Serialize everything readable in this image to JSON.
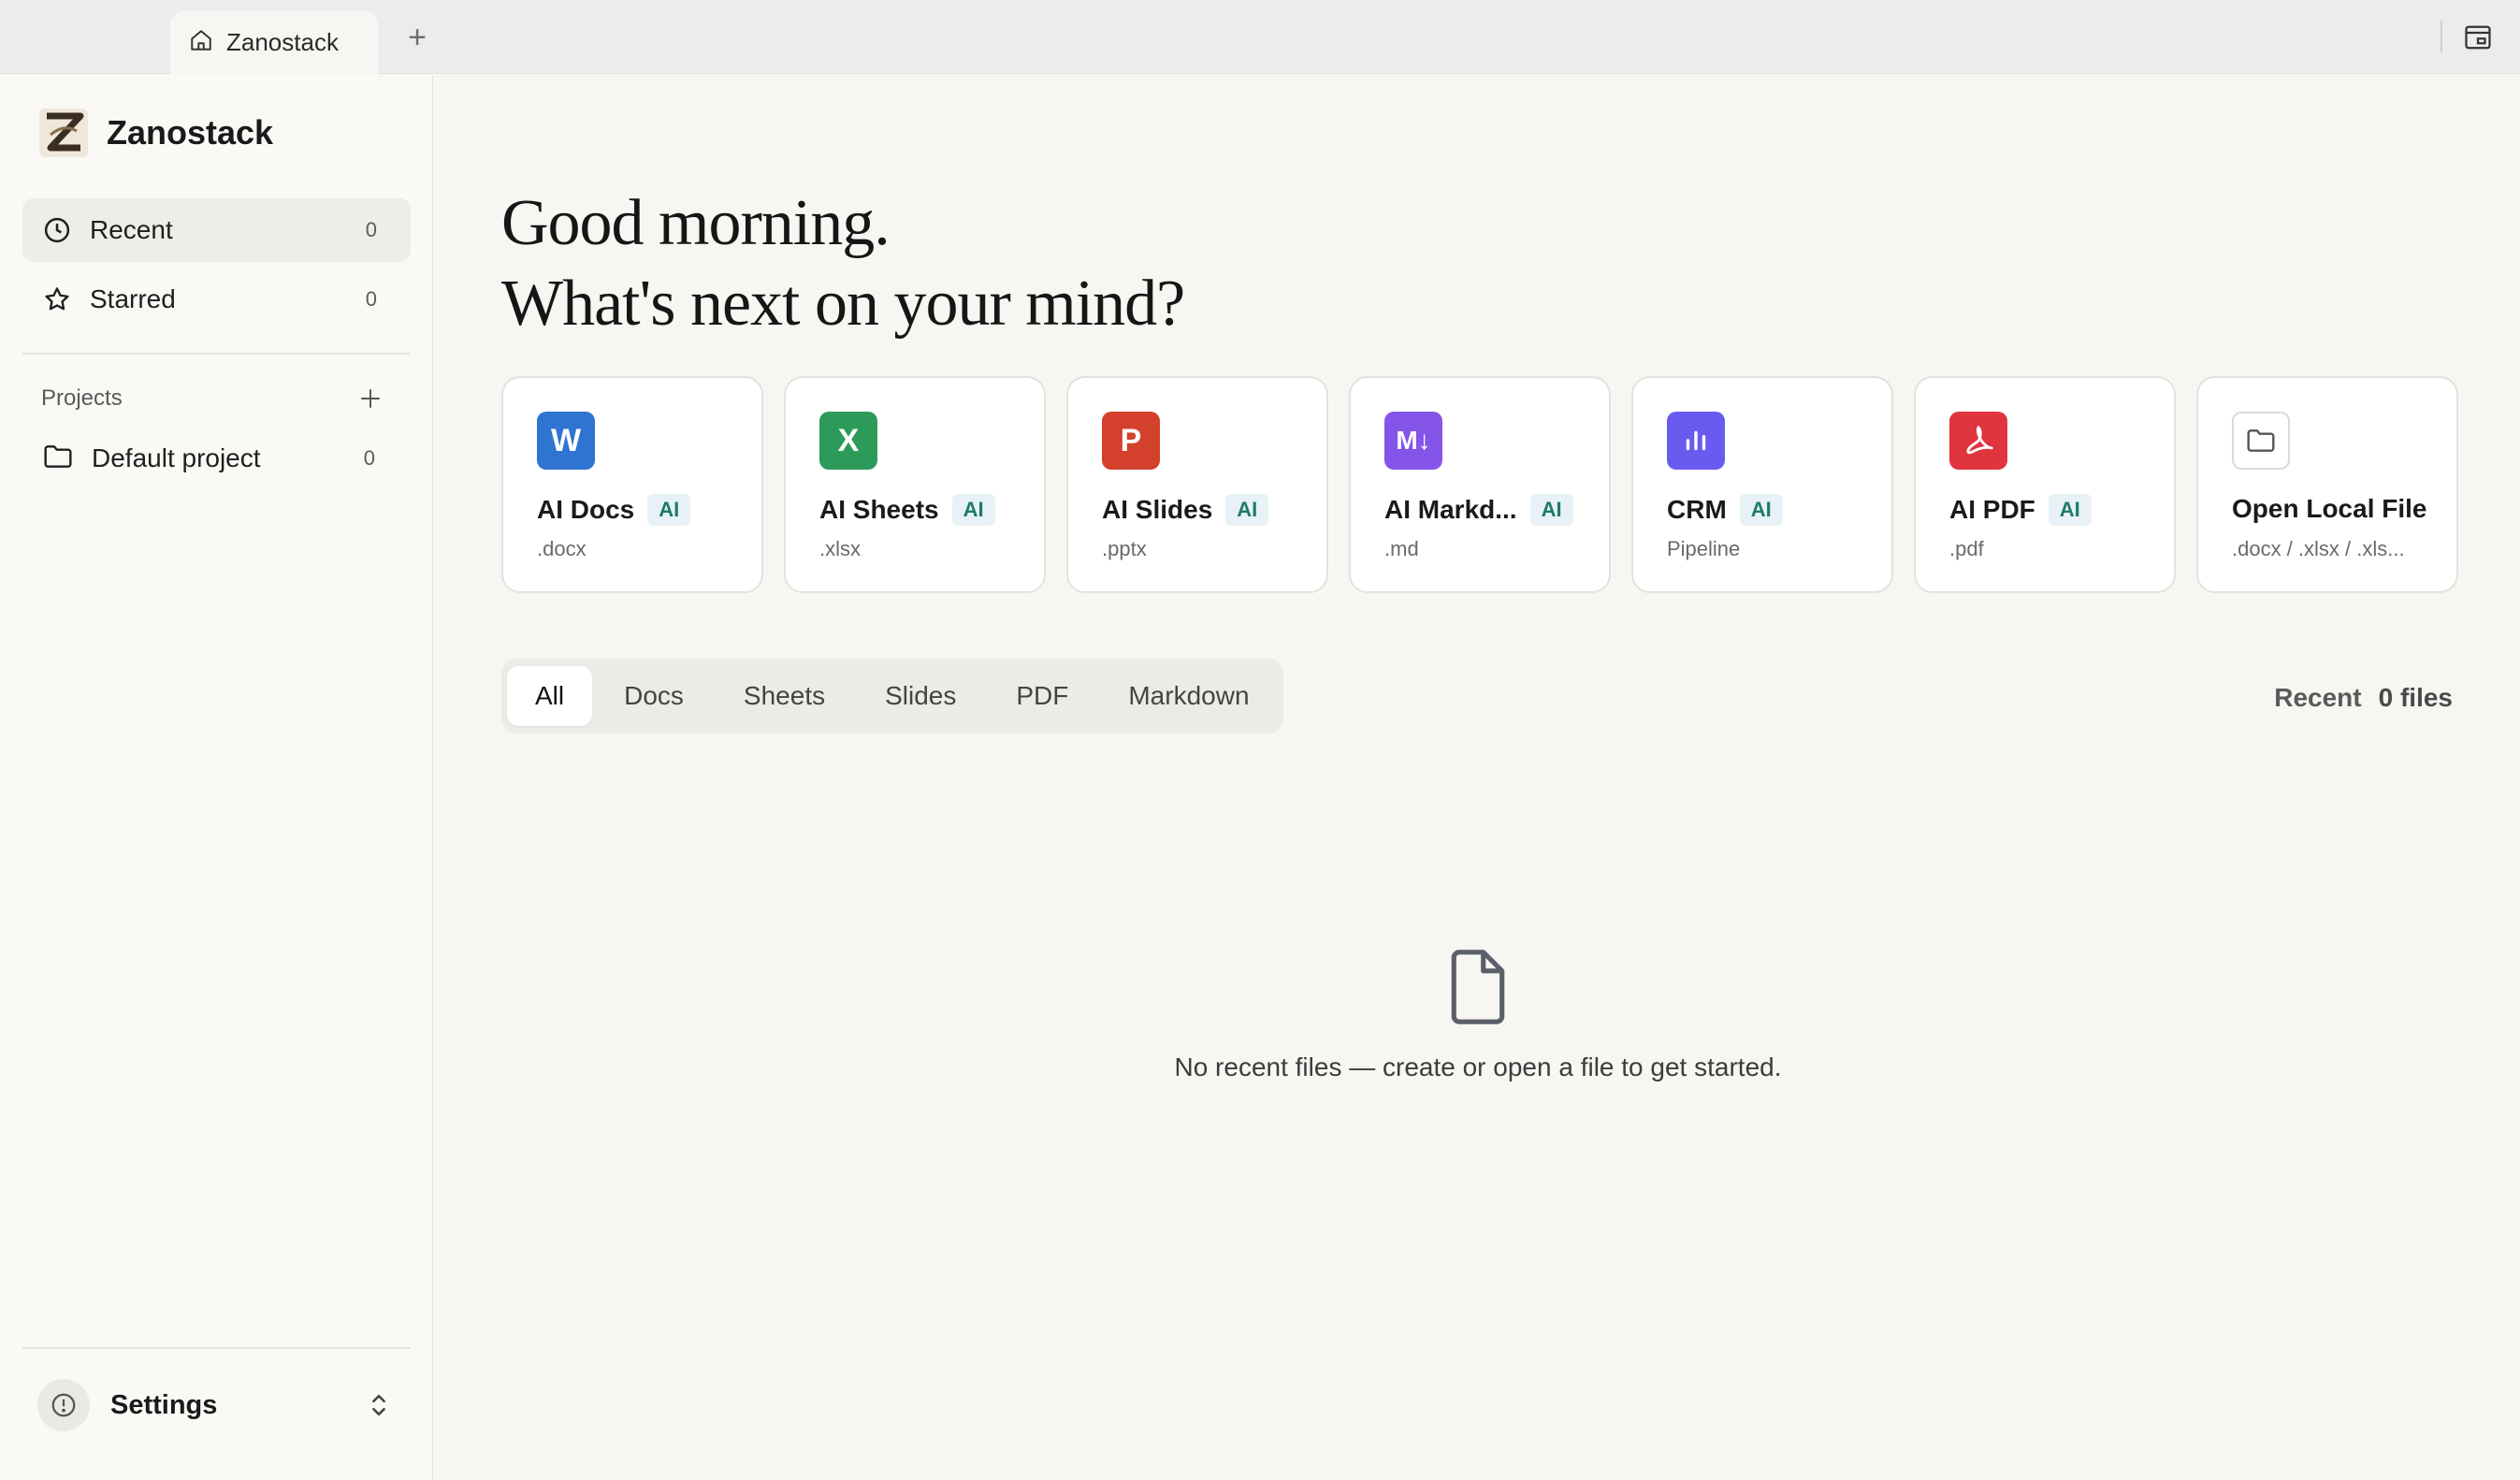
{
  "tab": {
    "title": "Zanostack",
    "add_label": "+"
  },
  "brand": {
    "name": "Zanostack"
  },
  "nav": {
    "recent": {
      "label": "Recent",
      "count": "0"
    },
    "starred": {
      "label": "Starred",
      "count": "0"
    }
  },
  "projects": {
    "header": "Projects",
    "items": [
      {
        "label": "Default project",
        "count": "0"
      }
    ]
  },
  "settings": {
    "label": "Settings"
  },
  "greeting": {
    "line1": "Good morning.",
    "line2": "What's next on your mind?"
  },
  "cards": [
    {
      "title": "AI Docs",
      "badge": "AI",
      "sub": ".docx",
      "glyph": "W",
      "color": "#2f74d0"
    },
    {
      "title": "AI Sheets",
      "badge": "AI",
      "sub": ".xlsx",
      "glyph": "X",
      "color": "#2e9a5a"
    },
    {
      "title": "AI Slides",
      "badge": "AI",
      "sub": ".pptx",
      "glyph": "P",
      "color": "#d3402b"
    },
    {
      "title": "AI Markd...",
      "badge": "AI",
      "sub": ".md",
      "glyph": "M↓",
      "color": "#8455e8"
    },
    {
      "title": "CRM",
      "badge": "AI",
      "sub": "Pipeline",
      "glyph": "chart-icon",
      "color": "#6a5bf0"
    },
    {
      "title": "AI PDF",
      "badge": "AI",
      "sub": ".pdf",
      "glyph": "pdf-icon",
      "color": "#e0343e"
    },
    {
      "title": "Open Local File",
      "sub": ".docx / .xlsx / .xls...",
      "glyph": "folder-icon",
      "color": "#ffffff"
    }
  ],
  "filters": [
    "All",
    "Docs",
    "Sheets",
    "Slides",
    "PDF",
    "Markdown"
  ],
  "recent_summary": {
    "label": "Recent",
    "count": "0 files"
  },
  "empty_state": {
    "text": "No recent files — create or open a file to get started."
  }
}
